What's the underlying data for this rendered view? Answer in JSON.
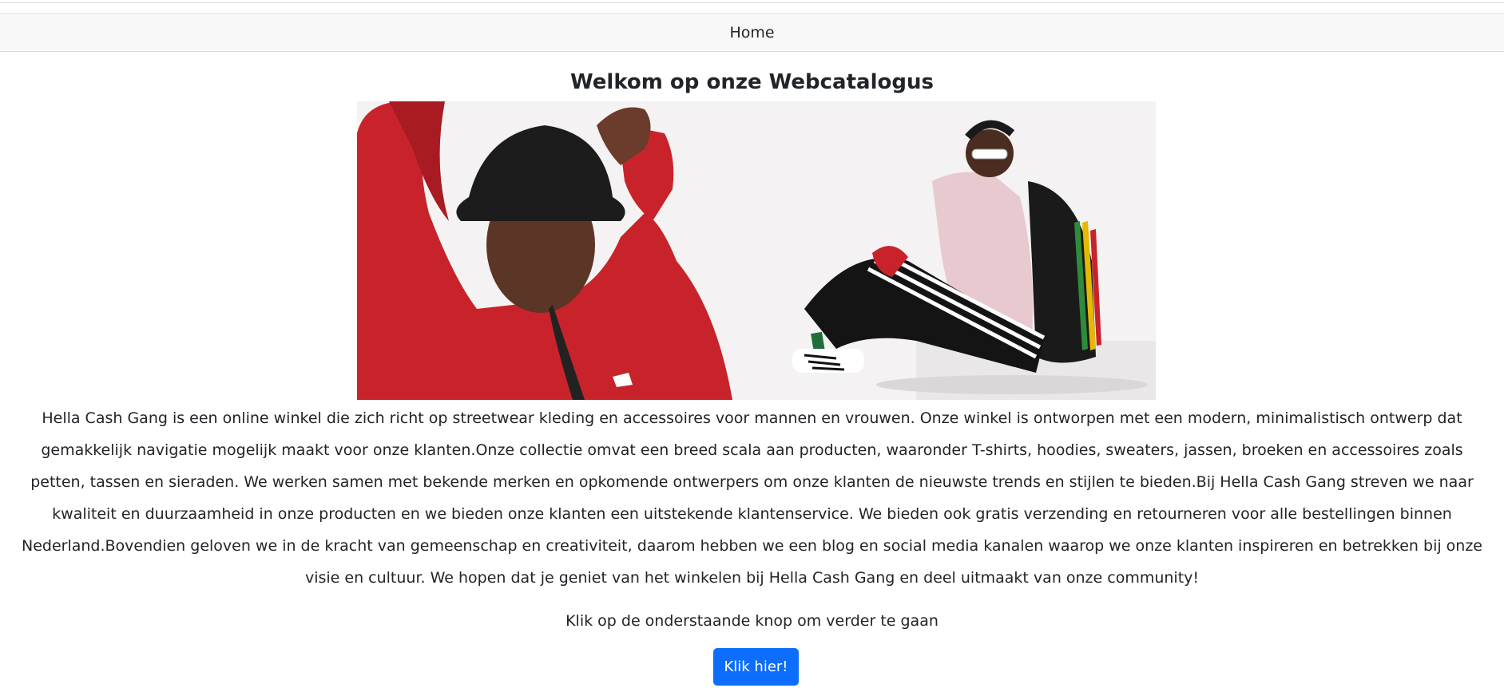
{
  "navbar": {
    "home_label": "Home"
  },
  "main": {
    "title": "Welkom op onze Webcatalogus",
    "description": "Hella Cash Gang is een online winkel die zich richt op streetwear kleding en accessoires voor mannen en vrouwen. Onze winkel is ontworpen met een modern, minimalistisch ontwerp dat gemakkelijk navigatie mogelijk maakt voor onze klanten.Onze collectie omvat een breed scala aan producten, waaronder T-shirts, hoodies, sweaters, jassen, broeken en accessoires zoals petten, tassen en sieraden. We werken samen met bekende merken en opkomende ontwerpers om onze klanten de nieuwste trends en stijlen te bieden.Bij Hella Cash Gang streven we naar kwaliteit en duurzaamheid in onze producten en we bieden onze klanten een uitstekende klantenservice. We bieden ook gratis verzending en retourneren voor alle bestellingen binnen Nederland.Bovendien geloven we in de kracht van gemeenschap en creativiteit, daarom hebben we een blog en social media kanalen waarop we onze klanten inspireren en betrekken bij onze visie en cultuur. We hopen dat je geniet van het winkelen bij Hella Cash Gang en deel uitmaakt van onze community!",
    "instruction": "Klik op de onderstaande knop om verder te gaan",
    "button_label": "Klik hier!"
  },
  "colors": {
    "primary_button": "#0d6efd",
    "navbar_bg": "#f8f8f8",
    "hoodie_red": "#c8232b"
  }
}
